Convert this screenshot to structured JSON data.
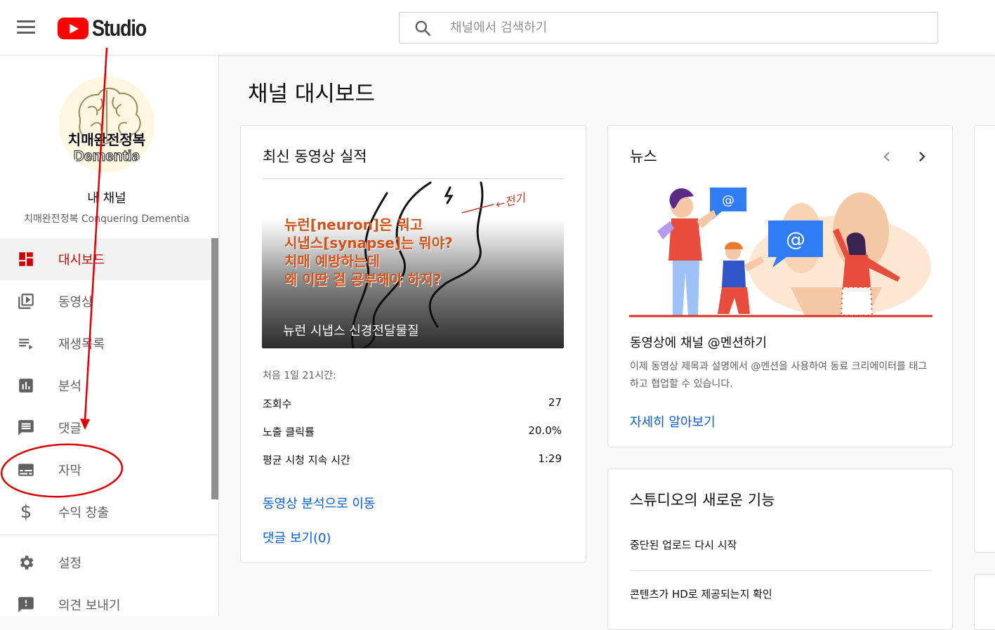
{
  "app": {
    "logo_text": "Studio",
    "brand_color": "#ff0000"
  },
  "search": {
    "placeholder": "채널에서 검색하기"
  },
  "sidebar": {
    "avatar_text_1": "치매완전정복",
    "avatar_text_2": "Dementia",
    "my_channel_label": "내 채널",
    "channel_name": "치매완전정복 Conquering Dementia",
    "items": [
      {
        "label": "대시보드",
        "icon": "dashboard-icon",
        "active": true
      },
      {
        "label": "동영상",
        "icon": "video-library-icon"
      },
      {
        "label": "재생목록",
        "icon": "playlist-icon"
      },
      {
        "label": "분석",
        "icon": "analytics-icon"
      },
      {
        "label": "댓글",
        "icon": "comments-icon"
      },
      {
        "label": "자막",
        "icon": "subtitles-icon"
      },
      {
        "label": "수익 창출",
        "icon": "dollar-icon"
      }
    ],
    "bottom_items": [
      {
        "label": "설정",
        "icon": "gear-icon"
      },
      {
        "label": "의견 보내기",
        "icon": "feedback-icon"
      }
    ]
  },
  "main": {
    "title": "채널 대시보드"
  },
  "latest_video": {
    "title": "최신 동영상 실적",
    "thumbnail_lines": [
      "뉴런[neuron]은 뭐고",
      "시냅스[synapse]는 뭐야?",
      "치매 예방하는데",
      "왜 이딴 걸 공부해야 하지?"
    ],
    "thumbnail_note": "←전기",
    "video_title": "뉴런 시냅스 신경전달물질",
    "first_period": "처음 1일 21시간:",
    "stats": [
      {
        "label": "조회수",
        "value": "27"
      },
      {
        "label": "노출 클릭률",
        "value": "20.0%"
      },
      {
        "label": "평균 시청 지속 시간",
        "value": "1:29"
      }
    ],
    "analytics_link": "동영상 분석으로 이동",
    "comments_link": "댓글 보기(0)"
  },
  "news": {
    "title": "뉴스",
    "headline": "동영상에 채널 @멘션하기",
    "description": "이제 동영상 제목과 설명에서 @멘션을 사용하여 동료 크리에이터를 태그하고 협업할 수 있습니다.",
    "link": "자세히 알아보기"
  },
  "whats_new": {
    "title": "스튜디오의 새로운 기능",
    "items": [
      "중단된 업로드 다시 시작",
      "콘텐츠가 HD로 제공되는지 확인"
    ]
  },
  "annotation_color": "#e00000"
}
